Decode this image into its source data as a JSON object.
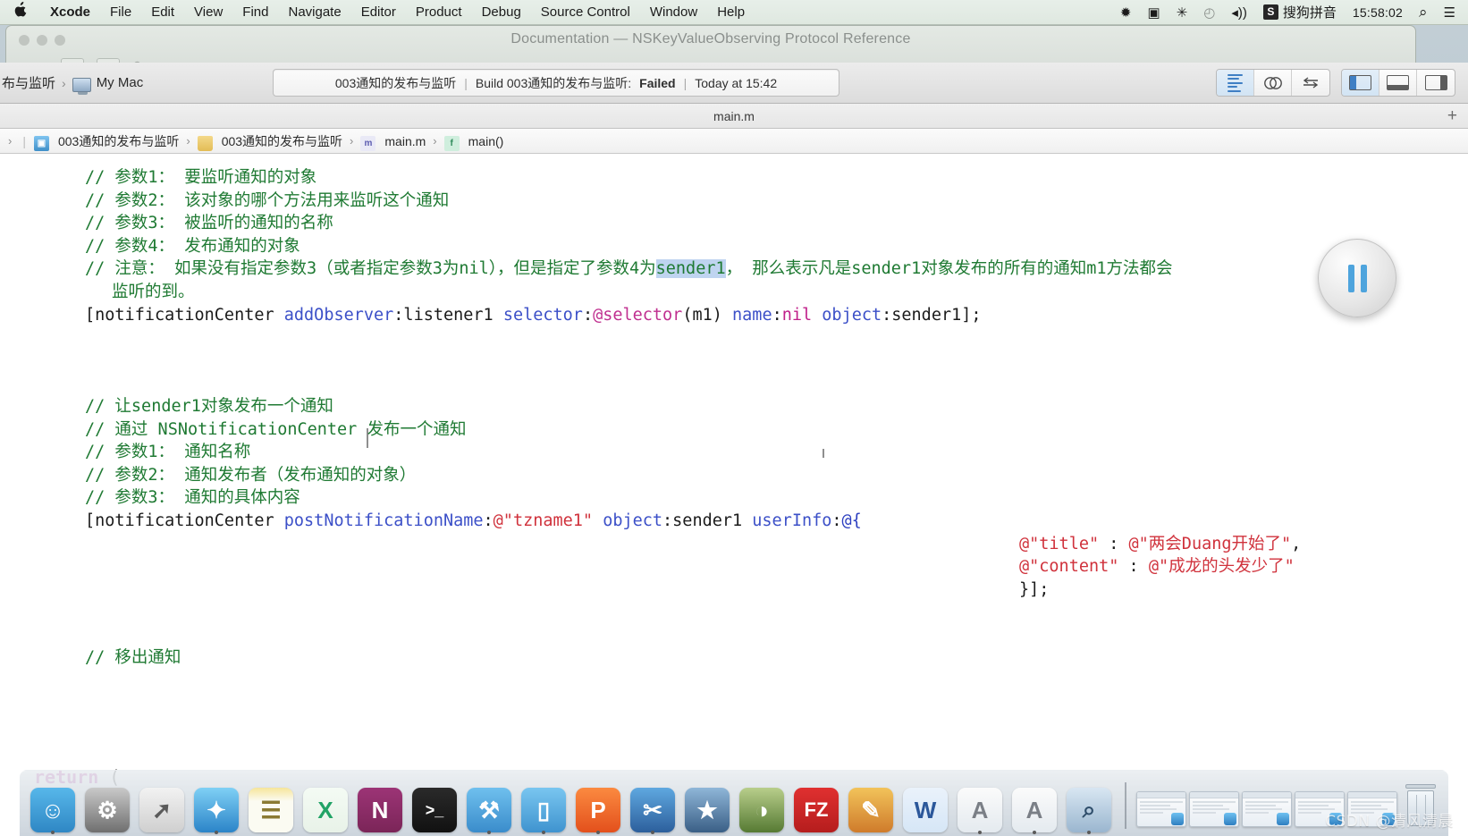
{
  "menubar": {
    "apple_icon": "apple-logo-icon",
    "items": [
      {
        "label": "Xcode",
        "bold": true
      },
      {
        "label": "File",
        "bold": false
      },
      {
        "label": "Edit",
        "bold": false
      },
      {
        "label": "View",
        "bold": false
      },
      {
        "label": "Find",
        "bold": false
      },
      {
        "label": "Navigate",
        "bold": false
      },
      {
        "label": "Editor",
        "bold": false
      },
      {
        "label": "Product",
        "bold": false
      },
      {
        "label": "Debug",
        "bold": false
      },
      {
        "label": "Source Control",
        "bold": false
      },
      {
        "label": "Window",
        "bold": false
      },
      {
        "label": "Help",
        "bold": false
      }
    ],
    "status_items": [
      {
        "name": "bluetooth-icon",
        "glyph": "✹"
      },
      {
        "name": "screen-recording-icon",
        "glyph": "▣"
      },
      {
        "name": "airplay-icon",
        "glyph": "✳"
      },
      {
        "name": "time-machine-icon",
        "glyph": "◴"
      },
      {
        "name": "volume-icon",
        "glyph": "◂))"
      }
    ],
    "input_method_badge": "S",
    "input_method": "搜狗拼音",
    "clock": "15:58:02",
    "search_icon": "⌕",
    "control_center_icon": "☰"
  },
  "background_window": {
    "title": "Documentation — NSKeyValueObserving Protocol Reference"
  },
  "toolbar": {
    "scheme_prefix": "布与监听",
    "scheme_sep": "›",
    "destination": "My Mac",
    "status": {
      "project": "003通知的发布与监听",
      "build_prefix": "Build 003通知的发布与监听:",
      "build_result": "Failed",
      "timestamp": "Today at 15:42",
      "divider": "|"
    },
    "editor_modes": [
      {
        "name": "standard-editor-button",
        "active": true
      },
      {
        "name": "assistant-editor-button",
        "active": false
      },
      {
        "name": "version-editor-button",
        "active": false
      }
    ],
    "view_toggles": [
      {
        "name": "toggle-navigator-button",
        "active": true
      },
      {
        "name": "toggle-debug-area-button",
        "active": false
      },
      {
        "name": "toggle-utilities-button",
        "active": false
      }
    ]
  },
  "tabbar": {
    "active_tab": "main.m",
    "add_tab_icon": "+"
  },
  "jumpbar": {
    "leading_chevron": "›",
    "items": [
      {
        "label": "003通知的发布与监听",
        "icon": "project-icon"
      },
      {
        "label": "003通知的发布与监听",
        "icon": "folder-icon"
      },
      {
        "label": "main.m",
        "icon": "objc-file-icon"
      },
      {
        "label": "main()",
        "icon": "function-icon"
      }
    ]
  },
  "editor": {
    "lines": [
      {
        "id": "l1",
        "indent": 0,
        "segments": [
          {
            "t": "// 参数1： 要监听通知的对象",
            "c": "cmt"
          }
        ]
      },
      {
        "id": "l2",
        "indent": 0,
        "segments": [
          {
            "t": "// 参数2： 该对象的哪个方法用来监听这个通知",
            "c": "cmt"
          }
        ]
      },
      {
        "id": "l3",
        "indent": 0,
        "segments": [
          {
            "t": "// 参数3： 被监听的通知的名称",
            "c": "cmt"
          }
        ]
      },
      {
        "id": "l4",
        "indent": 0,
        "segments": [
          {
            "t": "// 参数4： 发布通知的对象",
            "c": "cmt"
          }
        ]
      },
      {
        "id": "l5",
        "indent": 0,
        "segments": [
          {
            "t": "// 注意： 如果没有指定参数3（或者指定参数3为nil），但是指定了参数4为",
            "c": "cmt"
          },
          {
            "t": "sender1",
            "c": "cmt sel"
          },
          {
            "t": "， 那么表示凡是sender1对象发布的所有的通知m1方法都会",
            "c": "cmt"
          }
        ]
      },
      {
        "id": "l6",
        "indent": 1,
        "segments": [
          {
            "t": "监听的到。",
            "c": "cmt"
          }
        ]
      },
      {
        "id": "l7",
        "indent": 0,
        "segments": [
          {
            "t": "[notificationCenter ",
            "c": "plain"
          },
          {
            "t": "addObserver",
            "c": "kwmeth"
          },
          {
            "t": ":listener1 ",
            "c": "plain"
          },
          {
            "t": "selector",
            "c": "kwmeth"
          },
          {
            "t": ":",
            "c": "plain"
          },
          {
            "t": "@selector",
            "c": "kwsel"
          },
          {
            "t": "(m1) ",
            "c": "plain"
          },
          {
            "t": "name",
            "c": "kwmeth"
          },
          {
            "t": ":",
            "c": "plain"
          },
          {
            "t": "nil",
            "c": "kwnil"
          },
          {
            "t": " ",
            "c": "plain"
          },
          {
            "t": "object",
            "c": "kwmeth"
          },
          {
            "t": ":sender1];",
            "c": "plain"
          }
        ]
      },
      {
        "id": "l8",
        "indent": 0,
        "segments": []
      },
      {
        "id": "l9",
        "indent": 0,
        "segments": []
      },
      {
        "id": "l10",
        "indent": 0,
        "segments": []
      },
      {
        "id": "l11",
        "indent": 0,
        "segments": [
          {
            "t": "// 让sender1对象发布一个通知",
            "c": "cmt"
          }
        ]
      },
      {
        "id": "l12",
        "indent": 0,
        "segments": [
          {
            "t": "// 通过 NSNotificationCenter 发布一个通知",
            "c": "cmt"
          }
        ]
      },
      {
        "id": "l13",
        "indent": 0,
        "segments": [
          {
            "t": "// 参数1： 通知名称",
            "c": "cmt"
          }
        ]
      },
      {
        "id": "l14",
        "indent": 0,
        "segments": [
          {
            "t": "// 参数2： 通知发布者（发布通知的对象）",
            "c": "cmt"
          }
        ]
      },
      {
        "id": "l15",
        "indent": 0,
        "segments": [
          {
            "t": "// 参数3： 通知的具体内容",
            "c": "cmt"
          }
        ]
      },
      {
        "id": "l16",
        "indent": 0,
        "segments": [
          {
            "t": "[notificationCenter ",
            "c": "plain"
          },
          {
            "t": "postNotificationName",
            "c": "kwmeth"
          },
          {
            "t": ":",
            "c": "plain"
          },
          {
            "t": "@\"tzname1\"",
            "c": "str"
          },
          {
            "t": " ",
            "c": "plain"
          },
          {
            "t": "object",
            "c": "kwmeth"
          },
          {
            "t": ":sender1 ",
            "c": "plain"
          },
          {
            "t": "userInfo",
            "c": "kwmeth"
          },
          {
            "t": ":",
            "c": "plain"
          },
          {
            "t": "@{",
            "c": "atsym"
          }
        ]
      },
      {
        "id": "l17",
        "indent": 2,
        "segments": [
          {
            "t": "@\"title\"",
            "c": "str"
          },
          {
            "t": " : ",
            "c": "plain"
          },
          {
            "t": "@\"两会Duang开始了\"",
            "c": "str"
          },
          {
            "t": ",",
            "c": "plain"
          }
        ]
      },
      {
        "id": "l18",
        "indent": 2,
        "segments": [
          {
            "t": "@\"content\"",
            "c": "str"
          },
          {
            "t": " : ",
            "c": "plain"
          },
          {
            "t": "@\"成龙的头发少了\"",
            "c": "str"
          }
        ]
      },
      {
        "id": "l19",
        "indent": 2,
        "segments": [
          {
            "t": "}];",
            "c": "plain"
          }
        ]
      },
      {
        "id": "l20",
        "indent": 0,
        "segments": []
      },
      {
        "id": "l21",
        "indent": 0,
        "segments": []
      },
      {
        "id": "l22",
        "indent": 0,
        "segments": [
          {
            "t": "// 移出通知",
            "c": "cmt"
          }
        ]
      }
    ],
    "bottom_lines": [
      {
        "id": "b1",
        "segments": [
          {
            "t": "}",
            "c": "plain"
          }
        ]
      },
      {
        "id": "b2",
        "segments": [
          {
            "t": "return ",
            "c": "kwret"
          },
          {
            "t": "(",
            "c": "plain"
          }
        ]
      }
    ]
  },
  "hud": {
    "name": "pause-hud",
    "state": "paused"
  },
  "dock": {
    "items": [
      {
        "name": "dock-finder",
        "label": "Finder",
        "glyph": "☺",
        "bg": "linear-gradient(180deg,#57b7ea 0%,#2f87c4 100%)",
        "running": true
      },
      {
        "name": "dock-system-preferences",
        "label": "System Preferences",
        "glyph": "⚙",
        "bg": "linear-gradient(180deg,#c9c9c9 0%,#6f6f6f 100%)",
        "running": false
      },
      {
        "name": "dock-launchpad",
        "label": "Launchpad",
        "glyph": "➚",
        "bg": "linear-gradient(180deg,#f2f2f2 0%,#cfcfcf 100%)",
        "running": false
      },
      {
        "name": "dock-safari",
        "label": "Safari",
        "glyph": "✦",
        "bg": "linear-gradient(180deg,#7fd0f5 0%,#2b84c8 100%)",
        "running": true
      },
      {
        "name": "dock-notes",
        "label": "Notes",
        "glyph": "☰",
        "bg": "linear-gradient(180deg,#f6e59a 0%,#fbfbf2 30%)",
        "running": false
      },
      {
        "name": "dock-excel",
        "label": "Excel",
        "glyph": "X",
        "bg": "linear-gradient(180deg,#f4fbf4 0%,#e8f2e8 100%)",
        "running": false
      },
      {
        "name": "dock-onenote",
        "label": "OneNote",
        "glyph": "N",
        "bg": "linear-gradient(180deg,#9c3476 0%,#7b2558 100%)",
        "running": false
      },
      {
        "name": "dock-terminal",
        "label": "Terminal",
        "glyph": ">_",
        "bg": "linear-gradient(180deg,#2a2a2a 0%,#111111 100%)",
        "running": false
      },
      {
        "name": "dock-xcode",
        "label": "Xcode",
        "glyph": "⚒",
        "bg": "linear-gradient(180deg,#6fc0ee 0%,#3a8ccb 100%)",
        "running": true
      },
      {
        "name": "dock-simulator",
        "label": "Simulator",
        "glyph": "▯",
        "bg": "linear-gradient(180deg,#79c6f0 0%,#3f93cf 100%)",
        "running": true
      },
      {
        "name": "dock-pdf-expert",
        "label": "PDF",
        "glyph": "P",
        "bg": "linear-gradient(180deg,#fb8a40 0%,#e3501c 100%)",
        "running": true
      },
      {
        "name": "dock-snip",
        "label": "Snip",
        "glyph": "✂",
        "bg": "linear-gradient(180deg,#5fa8e0 0%,#2c5f9c 100%)",
        "running": true
      },
      {
        "name": "dock-imovie",
        "label": "iMovie",
        "glyph": "★",
        "bg": "linear-gradient(180deg,#8fb6d8 0%,#3a5f86 100%)",
        "running": false
      },
      {
        "name": "dock-navicat",
        "label": "Navicat",
        "glyph": "◑",
        "bg": "linear-gradient(180deg,#b8ce8b 0%,#567a33 100%)",
        "running": false
      },
      {
        "name": "dock-filezilla",
        "label": "FileZilla",
        "glyph": "FZ",
        "bg": "linear-gradient(180deg,#e03030 0%,#b51d1d 100%)",
        "running": false
      },
      {
        "name": "dock-paintbrush",
        "label": "Paintbrush",
        "glyph": "✎",
        "bg": "linear-gradient(180deg,#f2c35a 0%,#cf7b2b 100%)",
        "running": false
      },
      {
        "name": "dock-word",
        "label": "Word",
        "glyph": "W",
        "bg": "linear-gradient(180deg,#eaf2fb 0%,#d6e6f6 100%)",
        "running": false
      },
      {
        "name": "dock-textedit-1",
        "label": "TextEdit",
        "glyph": "A",
        "bg": "linear-gradient(180deg,#fbfbfb 0%,#e4eaef 100%)",
        "running": true
      },
      {
        "name": "dock-textedit-2",
        "label": "TextEdit",
        "glyph": "A",
        "bg": "linear-gradient(180deg,#fbfbfb 0%,#e4eaef 100%)",
        "running": true
      },
      {
        "name": "dock-preview",
        "label": "Preview",
        "glyph": "⌕",
        "bg": "linear-gradient(180deg,#d8e6f2 0%,#9ab6cf 100%)",
        "running": true
      }
    ],
    "minimized_count": 5,
    "trash_label": "Trash"
  },
  "watermark": {
    "text": "CSDN @清风清晨"
  }
}
